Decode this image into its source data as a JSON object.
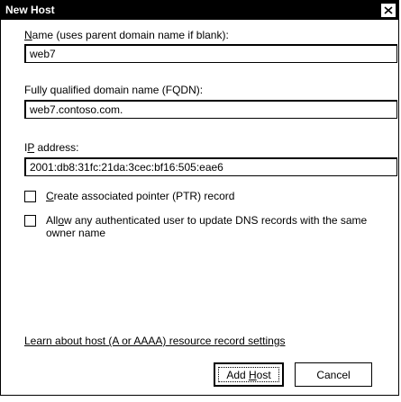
{
  "window": {
    "title": "New Host"
  },
  "name_field": {
    "label_pre": "",
    "label_access": "N",
    "label_post": "ame (uses parent domain name if blank):",
    "value": "web7"
  },
  "fqdn_field": {
    "label": "Fully qualified domain name (FQDN):",
    "value": "web7.contoso.com."
  },
  "ip_field": {
    "label_pre": "I",
    "label_access": "P",
    "label_post": " address:",
    "value": "2001:db8:31fc:21da:3cec:bf16:505:eae6"
  },
  "checkboxes": [
    {
      "label_pre": "",
      "label_access": "C",
      "label_post": "reate associated pointer (PTR) record",
      "checked": false
    },
    {
      "label_pre": "All",
      "label_access": "o",
      "label_post": "w any authenticated user to update DNS records with the same owner name",
      "checked": false
    }
  ],
  "link": {
    "text": "Learn about host (A or AAAA) resource record settings"
  },
  "buttons": {
    "add_pre": "Add ",
    "add_access": "H",
    "add_post": "ost",
    "cancel": "Cancel"
  }
}
